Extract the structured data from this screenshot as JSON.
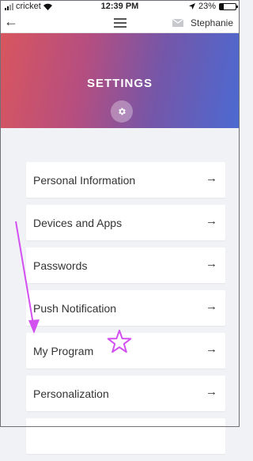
{
  "status_bar": {
    "carrier": "cricket",
    "time": "12:39 PM",
    "battery": "23%",
    "battery_level": 0.23
  },
  "nav": {
    "back_icon": "back-arrow-icon",
    "menu_icon": "hamburger-menu-icon",
    "mail_icon": "mail-icon",
    "user_name": "Stephanie"
  },
  "header": {
    "title": "SETTINGS",
    "icon": "gear-icon",
    "gradient": [
      "#d8565e",
      "#b54e80",
      "#7556a8",
      "#4b6ad2"
    ]
  },
  "settings": {
    "items": [
      {
        "label": "Personal Information"
      },
      {
        "label": "Devices and Apps"
      },
      {
        "label": "Passwords"
      },
      {
        "label": "Push Notification"
      },
      {
        "label": "My Program"
      },
      {
        "label": "Personalization"
      },
      {
        "label": ""
      }
    ],
    "arrow_icon": "right-arrow-icon"
  },
  "annotations": {
    "color": "#d24ff0",
    "arrow": "annotation-arrow",
    "star": "annotation-star"
  }
}
